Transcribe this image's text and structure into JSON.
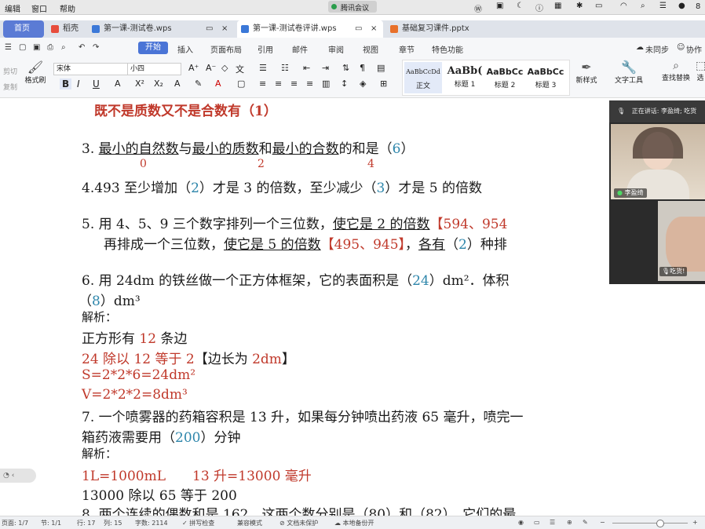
{
  "menubar": {
    "items": [
      "编辑",
      "窗口",
      "帮助"
    ],
    "meeting_label": "腾讯会议",
    "clock": "8"
  },
  "tabs": [
    {
      "label": "首页",
      "active": false
    },
    {
      "label": "稻壳",
      "active": false
    },
    {
      "label": "第一课-测试卷.wps",
      "active": false
    },
    {
      "label": "第一课-测试卷评讲.wps",
      "active": true
    },
    {
      "label": "基础复习课件.pptx",
      "active": false
    }
  ],
  "toolbar": {
    "start_label": "开始",
    "items": [
      "插入",
      "页面布局",
      "引用",
      "邮件",
      "审阅",
      "视图",
      "章节",
      "特色功能"
    ],
    "sync_label": "未同步",
    "collab_label": "协作"
  },
  "ribbon": {
    "cut": "剪切",
    "copy": "复制",
    "format_painter": "格式刷",
    "font_name": "宋体",
    "font_size": "小四",
    "styles": [
      {
        "sample": "AaBbCcDd",
        "label": "正文"
      },
      {
        "sample": "AaBb(",
        "label": "标题 1"
      },
      {
        "sample": "AaBbCc",
        "label": "标题 2"
      },
      {
        "sample": "AaBbCc",
        "label": "标题 3"
      }
    ],
    "new_style": "新样式",
    "text_tools": "文字工具",
    "find_replace": "查找替换",
    "select": "选"
  },
  "document": {
    "l1": "既不是质数又不是合数有（1）",
    "l2_num": "3.",
    "l2_a": "最小的自然数",
    "l2_b": "与",
    "l2_c": "最小的质数",
    "l2_d": "和",
    "l2_e": "最小的合数",
    "l2_f": "的和是（",
    "l2_ans": "6",
    "l2_g": "）",
    "l3_a": "0",
    "l3_b": "2",
    "l3_c": "4",
    "l4_a": "4.493 至少增加（",
    "l4_ans1": "2",
    "l4_b": "）才是 3 的倍数，至少减少（",
    "l4_ans2": "3",
    "l4_c": "）才是 5 的倍数",
    "l5_a": "5. 用 4、5、9 三个数字排列一个三位数，",
    "l5_b": "使它是 2 的倍数",
    "l5_c": "【594、954",
    "l6_a": "再排成一个三位数，",
    "l6_b": "使它是 5 的倍数",
    "l6_c": "【495、945】",
    "l6_d": "，",
    "l6_e": "各有",
    "l6_f": "（",
    "l6_ans": "2",
    "l6_g": "）种排",
    "l7_a": "6. 用 24dm 的铁丝做一个正方体框架，它的表面积是（",
    "l7_ans": "24",
    "l7_b": "）dm²．体积",
    "l8_a": "（",
    "l8_ans": "8",
    "l8_b": "）dm³",
    "l9": "解析：",
    "l10_a": "正方形有 ",
    "l10_b": "12",
    "l10_c": " 条边",
    "l11_a": "24 除以 12 等于 2",
    "l11_b": "【边长为 ",
    "l11_c": "2dm",
    "l11_d": "】",
    "l12": "S=2*2*6=24dm²",
    "l13": "V=2*2*2=8dm³",
    "l14": "7. 一个喷雾器的药箱容积是 13 升，如果每分钟喷出药液 65 毫升，喷完一",
    "l15_a": "箱药液需要用（",
    "l15_ans": "200",
    "l15_b": "）分钟",
    "l16": "解析：",
    "l17": "1L=1000mL　　13 升=13000 毫升",
    "l18": "13000 除以 65 等于 200",
    "l19": "8. 两个连续的偶数和是 162，这两个数分别是（80）和（82），它们的最"
  },
  "video": {
    "header": "正在讲话: 李盈绮; 吃货",
    "user1": "李盈绮",
    "user2": "吃货!"
  },
  "status": {
    "page": "页面: 1/7",
    "section": "节: 1/1",
    "row": "行: 17",
    "col": "列: 15",
    "words": "字数: 2114",
    "spell": "拼写检查",
    "compat": "兼容模式",
    "protect": "文档未保护",
    "backup": "本地备份开"
  }
}
